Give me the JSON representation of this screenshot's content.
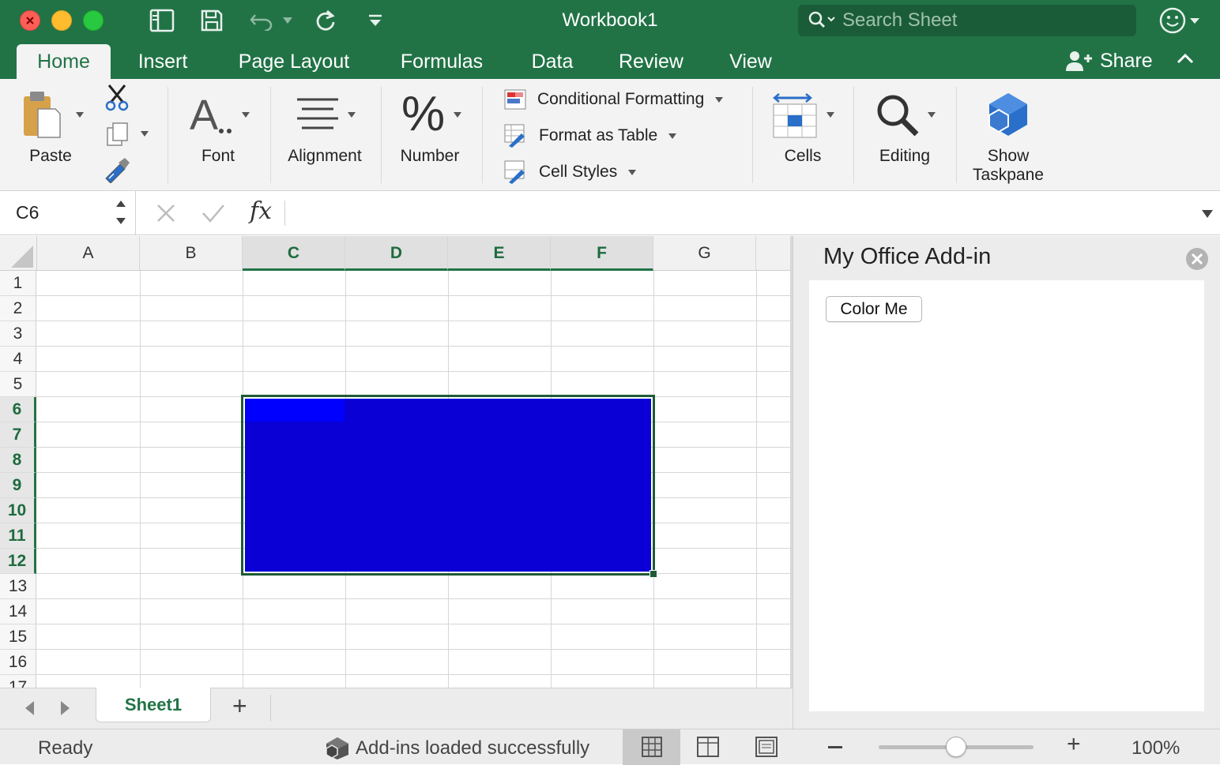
{
  "window": {
    "title": "Workbook1",
    "search_placeholder": "Search Sheet",
    "share_label": "Share"
  },
  "tabs": [
    {
      "label": "Home",
      "active": true
    },
    {
      "label": "Insert"
    },
    {
      "label": "Page Layout"
    },
    {
      "label": "Formulas"
    },
    {
      "label": "Data"
    },
    {
      "label": "Review"
    },
    {
      "label": "View"
    }
  ],
  "ribbon": {
    "paste": "Paste",
    "font": "Font",
    "alignment": "Alignment",
    "number": "Number",
    "conditional_formatting": "Conditional Formatting",
    "format_as_table": "Format as Table",
    "cell_styles": "Cell Styles",
    "cells": "Cells",
    "editing": "Editing",
    "show_taskpane_line1": "Show",
    "show_taskpane_line2": "Taskpane"
  },
  "formula_bar": {
    "name_box": "C6",
    "fx": "fx",
    "formula": ""
  },
  "grid": {
    "columns": [
      "A",
      "B",
      "C",
      "D",
      "E",
      "F",
      "G"
    ],
    "rows": [
      "1",
      "2",
      "3",
      "4",
      "5",
      "6",
      "7",
      "8",
      "9",
      "10",
      "11",
      "12",
      "13",
      "14",
      "15",
      "16",
      "17"
    ],
    "selected_range": "C6:F12",
    "selected_columns": [
      "C",
      "D",
      "E",
      "F"
    ],
    "selected_rows": [
      "6",
      "7",
      "8",
      "9",
      "10",
      "11",
      "12"
    ],
    "fill_color": "#0a00d6",
    "active_cell_color": "#0000ff"
  },
  "sheets": {
    "tabs": [
      {
        "label": "Sheet1",
        "active": true
      }
    ],
    "add_label": "+"
  },
  "taskpane": {
    "title": "My Office Add-in",
    "button_label": "Color Me"
  },
  "status": {
    "ready": "Ready",
    "addins_message": "Add-ins loaded successfully",
    "zoom": "100%",
    "zoom_level": 1.0
  },
  "colors": {
    "accent": "#217346",
    "selection_border": "#1e5a36"
  }
}
